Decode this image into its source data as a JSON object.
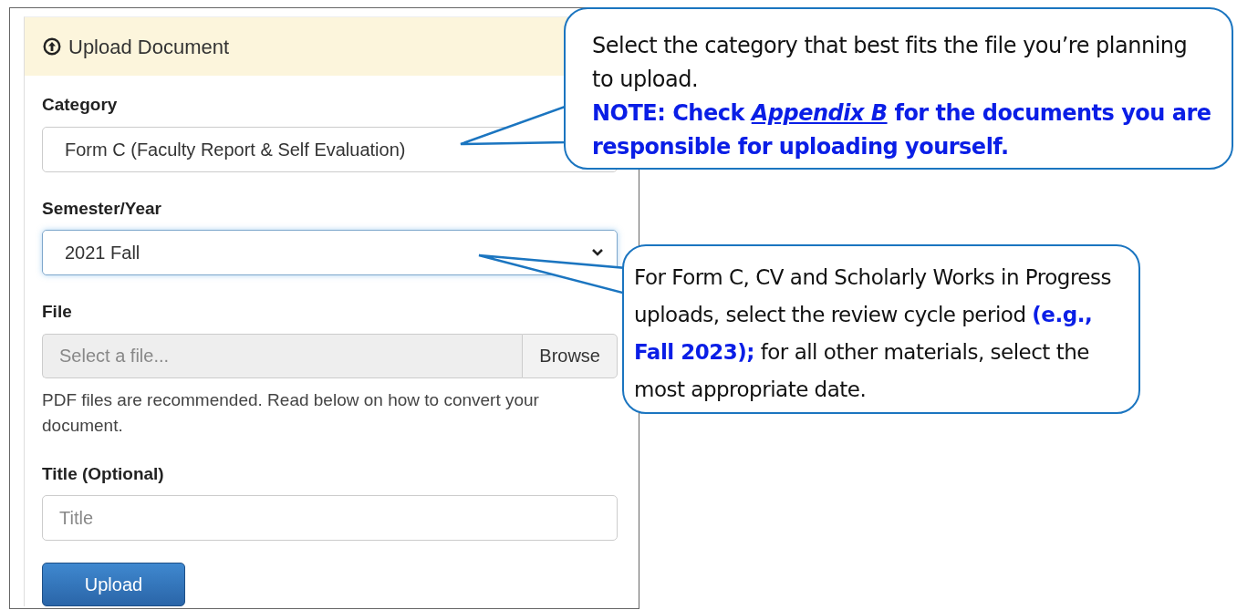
{
  "panel": {
    "title": "Upload Document",
    "fields": [
      {
        "kind": "combo",
        "label": "Category",
        "value": "Form C (Faculty Report & Self Evaluation)",
        "focused": false
      },
      {
        "kind": "select",
        "label": "Semester/Year",
        "value": "2021 Fall",
        "focused": true
      },
      {
        "kind": "file",
        "label": "File",
        "placeholder": "Select a file...",
        "button": "Browse",
        "help": "PDF files are recommended. Read below on how to convert your document."
      },
      {
        "kind": "text",
        "label": "Title (Optional)",
        "placeholder": "Title"
      }
    ],
    "submit": "Upload"
  },
  "callouts": [
    {
      "text": "Select the category that best fits the file you’re planning to upload.",
      "note": {
        "before": "NOTE: Check ",
        "link": "Appendix B",
        "after": " for the documents you are responsible for uploading yourself."
      }
    },
    {
      "text": "For Form C, CV and Scholarly Works in Progress uploads, select the review cycle period **(e.g., Fall 2023);** for all other materials, select the most appropriate date."
    }
  ]
}
